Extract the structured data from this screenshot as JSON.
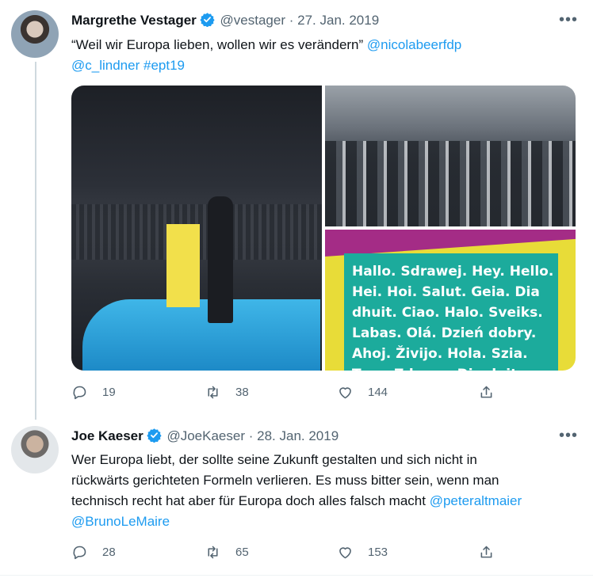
{
  "colors": {
    "link": "#1d9bf0",
    "muted": "#536471",
    "verified": "#1d9bf0"
  },
  "tweet1": {
    "name": "Margrethe Vestager",
    "handle": "@vestager",
    "date": "27. Jan. 2019",
    "text_plain": "“Weil wir Europa lieben, wollen wir es verändern”",
    "mention1": "@nicolabeerfdp",
    "mention2": "@c_lindner",
    "hashtag": "#ept19",
    "image_text": [
      "Hallo. Sdrawej. Hey. Hello.",
      "Hei. Hoi. Salut. Geia. Dia",
      "dhuit. Ciao. Halo. Sveiks.",
      "Labas. Olá. Dzień dobry.",
      "Ahoj. Živijo. Hola. Szia.",
      "Tere. Zdravo. Dia duit."
    ],
    "replies": "19",
    "retweets": "38",
    "likes": "144"
  },
  "tweet2": {
    "name": "Joe Kaeser",
    "handle": "@JoeKaeser",
    "date": "28. Jan. 2019",
    "line1": "Wer Europa liebt, der sollte seine Zukunft gestalten und sich nicht in",
    "line2": "rückwärts gerichteten Formeln verlieren. Es muss bitter sein, wenn man",
    "line3": "technisch recht hat aber für Europa doch alles falsch macht",
    "mention1": "@peteraltmaier",
    "mention2": "@BrunoLeMaire",
    "replies": "28",
    "retweets": "65",
    "likes": "153"
  },
  "icons": {
    "more": "more-icon",
    "reply": "reply-icon",
    "retweet": "retweet-icon",
    "like": "heart-icon",
    "share": "share-icon",
    "verified": "verified-badge-icon"
  },
  "separator": "·",
  "more_glyph": "•••"
}
